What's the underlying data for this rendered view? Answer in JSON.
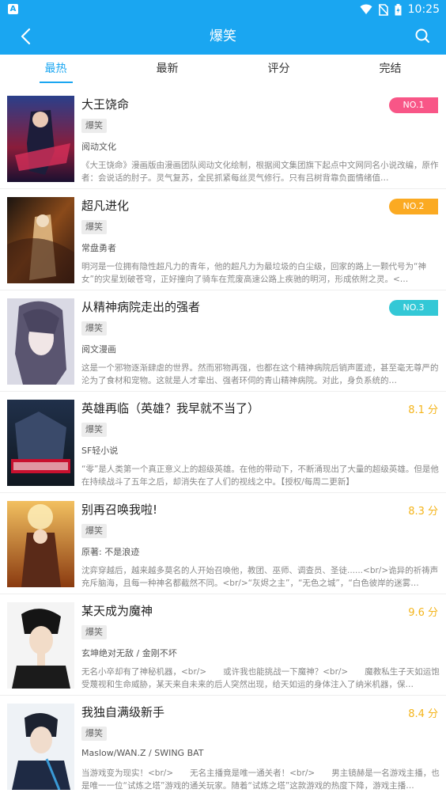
{
  "statusbar": {
    "time": "10:25",
    "notification_icon": "A"
  },
  "header": {
    "title": "爆笑"
  },
  "tabs": [
    {
      "label": "最热"
    },
    {
      "label": "最新"
    },
    {
      "label": "评分"
    },
    {
      "label": "完结"
    }
  ],
  "colors": {
    "accent": "#1aa6f1",
    "rank1": "#f85687",
    "rank2": "#fbaa22",
    "rank3": "#33c8d6",
    "score": "#f4b41a"
  },
  "items": [
    {
      "title": "大王饶命",
      "tag": "爆笑",
      "author": "阅动文化",
      "rank": "NO.1",
      "desc": "《大王饶命》漫画版由漫画团队阅动文化绘制，根据阅文集团旗下起点中文网同名小说改编，原作者：会说话的肘子。灵气复苏，全民抓紧每丝灵气修行。只有吕树背靠负面情绪值…"
    },
    {
      "title": "超凡进化",
      "tag": "爆笑",
      "author": "常盘勇者",
      "rank": "NO.2",
      "desc": "明河是一位拥有隐性超凡力的青年，他的超凡力为最垃圾的白尘级，回家的路上一颗代号为“神女”的灾星划破苍穹，正好撞向了骑车在荒废高速公路上疾驰的明河，形成依附之灵。<…"
    },
    {
      "title": "从精神病院走出的强者",
      "tag": "爆笑",
      "author": "阅文漫画",
      "rank": "NO.3",
      "desc": "这是一个邪物逐渐肆虐的世界。然而邪物再强，也都在这个精神病院后销声匿迹，甚至毫无尊严的沦为了食材和宠物。这就是人才辈出、强者环伺的青山精神病院。对此，身负系统的…"
    },
    {
      "title": "英雄再临（英雄？我早就不当了）",
      "tag": "爆笑",
      "author": "SF轻小说",
      "score": "8.1 分",
      "desc": "“零”是人类第一个真正意义上的超级英雄。在他的带动下，不断涌现出了大量的超级英雄。但是他在持续战斗了五年之后，却消失在了人们的视线之中。【授权/每周二更新】"
    },
    {
      "title": "别再召唤我啦!",
      "tag": "爆笑",
      "author": "原著: 不是浪迹",
      "score": "8.3 分",
      "desc": "沈弈穿越后，越来越多莫名的人开始召唤他，教团、巫师、调查员、圣徒......<br/>诡异的祈祷声充斥脑海，且每一种神名都截然不同。<br/>“灰烬之主”，“无色之城”，“白色彼岸的迷雾…"
    },
    {
      "title": "某天成为魔神",
      "tag": "爆笑",
      "author": "玄坤绝对无敌 / 金刚不坏",
      "score": "9.6 分",
      "desc": "无名小卒却有了神秘机器，<br/>　　或许我也能挑战一下魔神？<br/>　　魔教私生子天如运饱受蔑视和生命威胁，某天来自未来的后人突然出现，给天如运的身体注入了纳米机器，保…"
    },
    {
      "title": "我独自满级新手",
      "tag": "爆笑",
      "author": "Maslow/WAN.Z / SWING BAT",
      "score": "8.4 分",
      "desc": "当游戏变为现实！<br/>　　无名主播竟是唯一通关者！<br/>　　男主镜赫是一名游戏主播，也是唯一一位“试炼之塔”游戏的通关玩家。随着“试炼之塔”这款游戏的热度下降，游戏主播…"
    }
  ]
}
